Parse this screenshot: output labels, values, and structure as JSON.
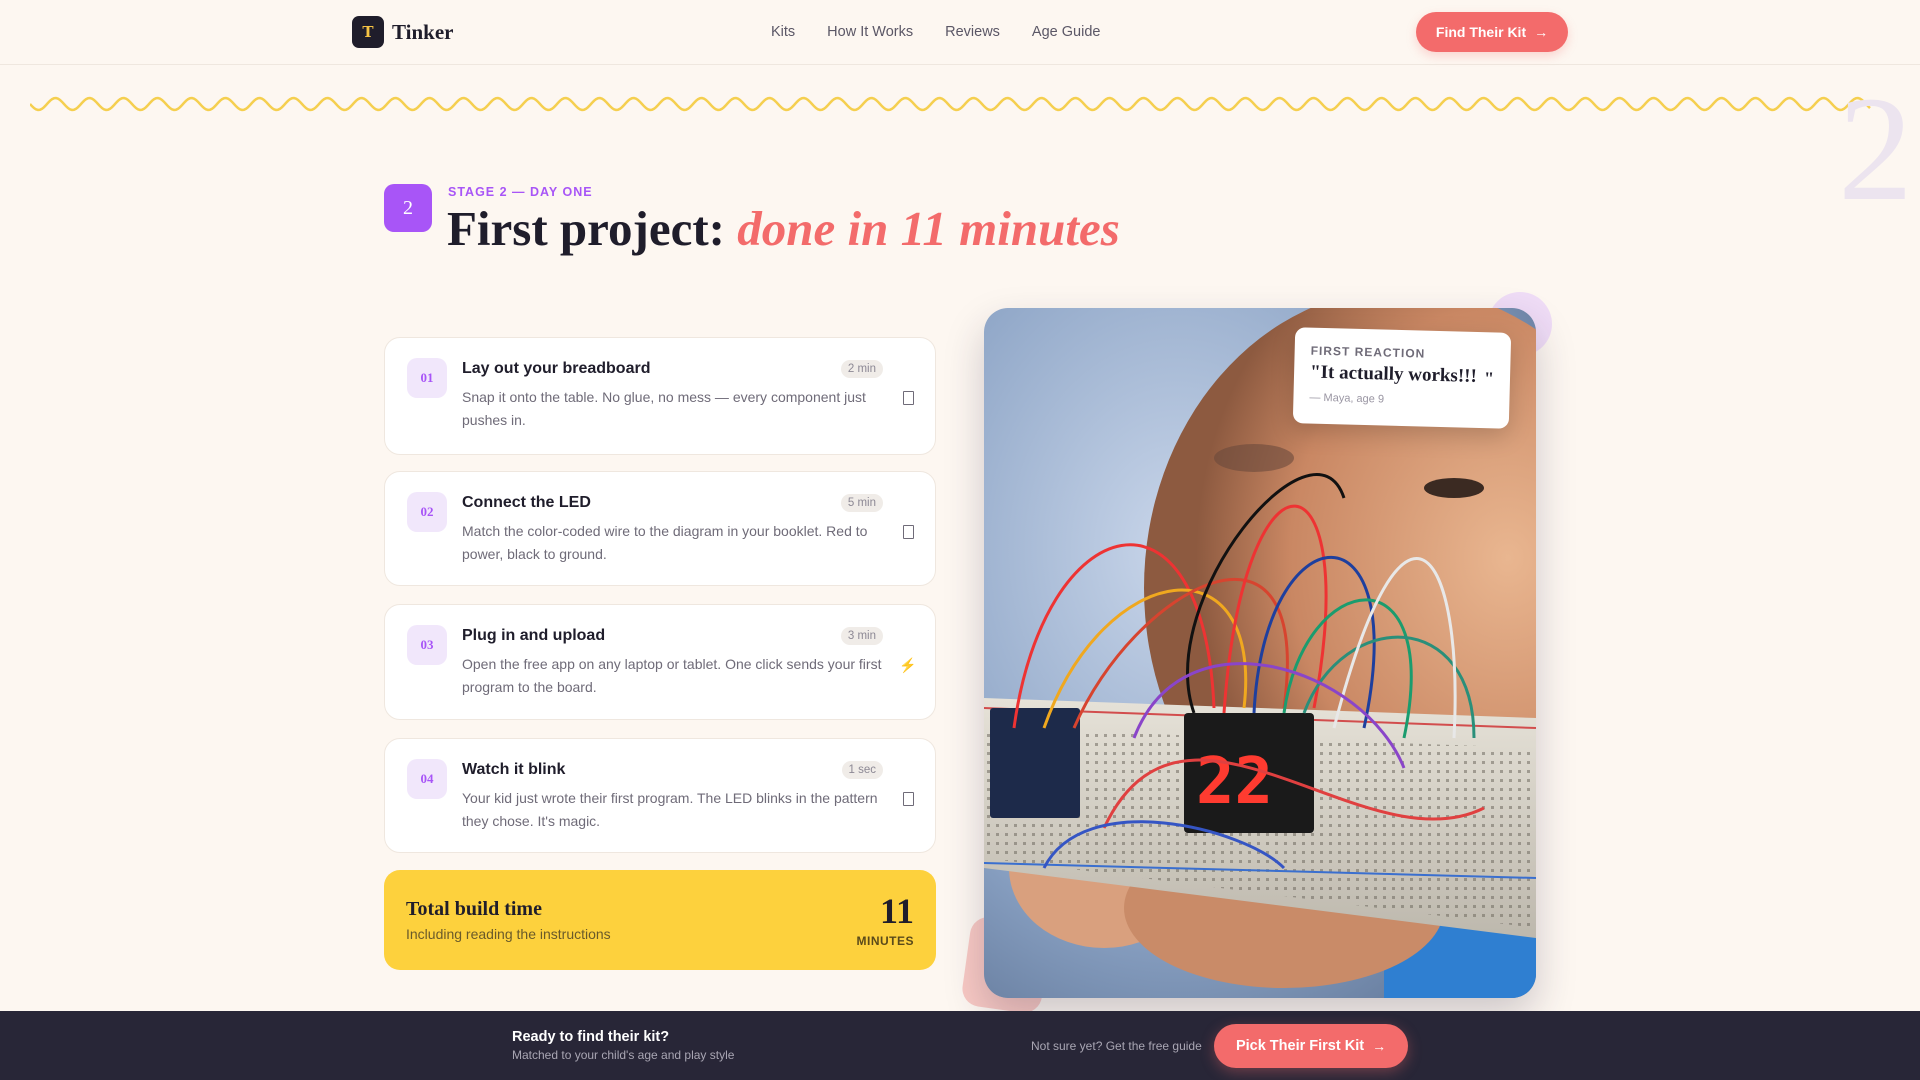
{
  "brand": {
    "logo_letter": "T",
    "name": "Tinker"
  },
  "nav": {
    "items": [
      "Kits",
      "How It Works",
      "Reviews",
      "Age Guide"
    ],
    "cta_label": "Find Their Kit"
  },
  "hero": {
    "stage_number": "2",
    "eyebrow": "STAGE 2 — DAY ONE",
    "title_plain": "First project: ",
    "title_accent": "done in 11 minutes",
    "watermark": "2"
  },
  "steps": [
    {
      "number": "01",
      "title": "Lay out your breadboard",
      "time": "2 min",
      "description": "Snap it onto the table. No glue, no mess — every component just pushes in.",
      "icon": "clipboard-icon"
    },
    {
      "number": "02",
      "title": "Connect the LED",
      "time": "5 min",
      "description": "Match the color-coded wire to the diagram in your booklet. Red to power, black to ground.",
      "icon": "clipboard-icon"
    },
    {
      "number": "03",
      "title": "Plug in and upload",
      "time": "3 min",
      "description": "Open the free app on any laptop or tablet. One click sends your first program to the board.",
      "icon": "lightning-icon",
      "icon_glyph": "⚡"
    },
    {
      "number": "04",
      "title": "Watch it blink",
      "time": "1 sec",
      "description": "Your kid just wrote their first program. The LED blinks in the pattern they chose. It's magic.",
      "icon": "clipboard-icon"
    }
  ],
  "total": {
    "title": "Total build time",
    "subtitle": "Including reading the instructions",
    "value": "11",
    "unit": "MINUTES"
  },
  "testimonial": {
    "label": "FIRST REACTION",
    "quote": "\"It actually works!!!",
    "close_mark": "\"",
    "author": "— Maya, age 9"
  },
  "bottom_bar": {
    "title": "Ready to find their kit?",
    "subtitle": "Matched to your child's age and play style",
    "note": "Not sure yet? Get the free guide",
    "cta_label": "Pick Their First Kit"
  },
  "colors": {
    "background": "#fdf7f1",
    "coral": "#f36b6b",
    "purple": "#a855f7",
    "yellow": "#fdd13d",
    "dark": "#282637"
  }
}
